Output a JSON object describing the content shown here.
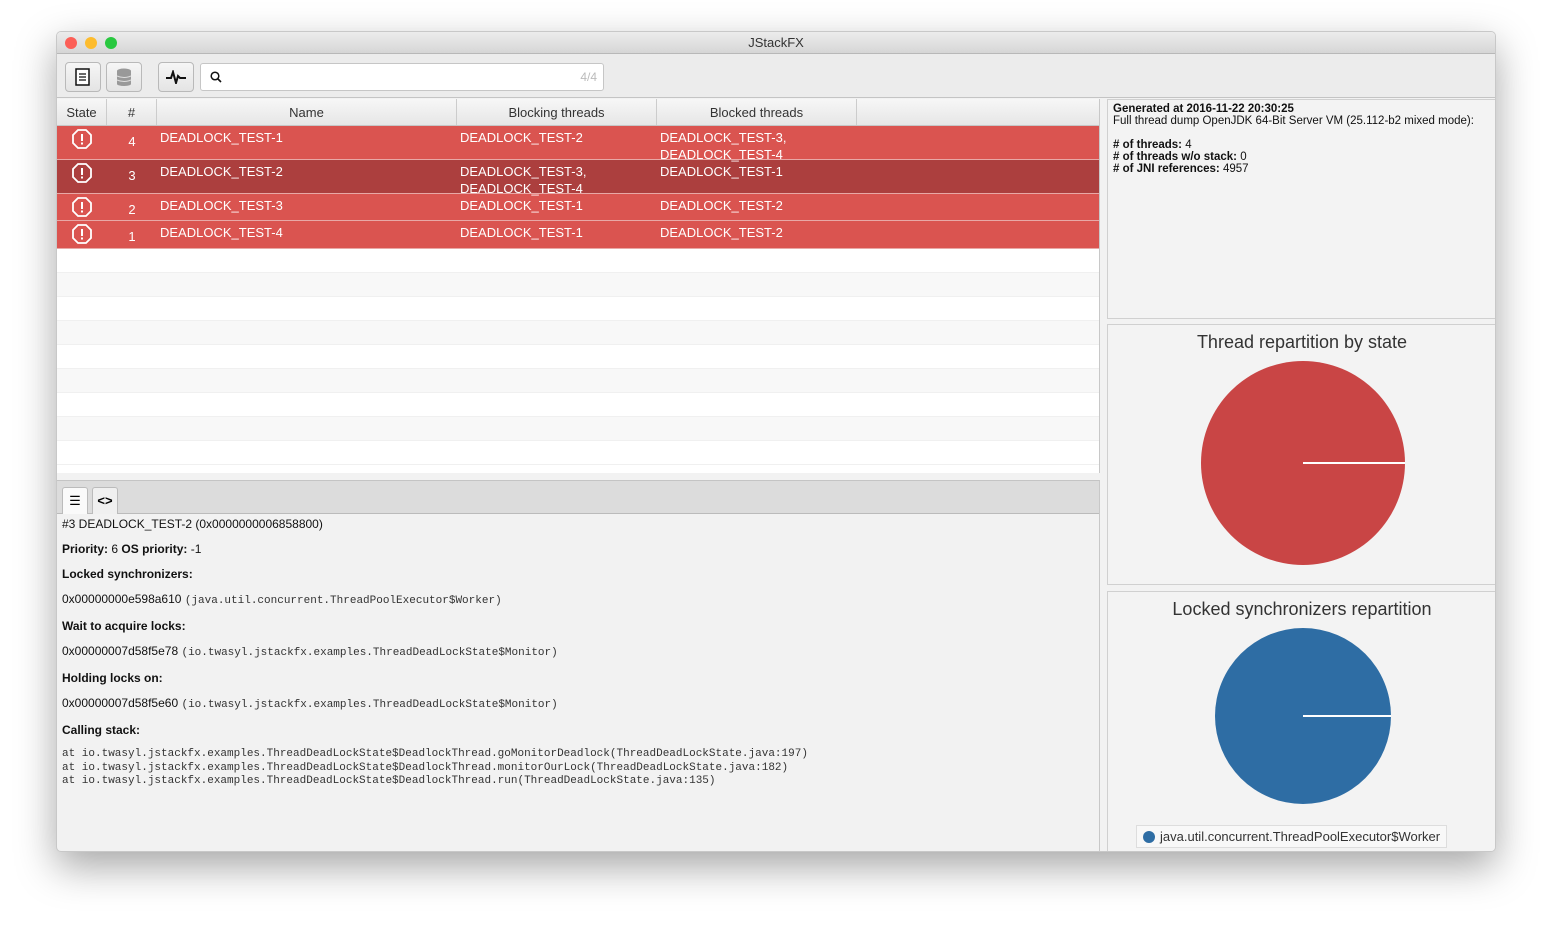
{
  "window": {
    "title": "JStackFX"
  },
  "toolbar": {
    "search_placeholder": "",
    "search_value": "",
    "match_count": "4/4"
  },
  "table": {
    "columns": [
      "State",
      "#",
      "Name",
      "Blocking threads",
      "Blocked threads"
    ],
    "rows": [
      {
        "state": "deadlock",
        "num": "4",
        "name": "DEADLOCK_TEST-1",
        "blocking": "DEADLOCK_TEST-2",
        "blocked": "DEADLOCK_TEST-3,\nDEADLOCK_TEST-4",
        "selected": false
      },
      {
        "state": "deadlock",
        "num": "3",
        "name": "DEADLOCK_TEST-2",
        "blocking": "DEADLOCK_TEST-3,\nDEADLOCK_TEST-4",
        "blocked": "DEADLOCK_TEST-1",
        "selected": true
      },
      {
        "state": "deadlock",
        "num": "2",
        "name": "DEADLOCK_TEST-3",
        "blocking": "DEADLOCK_TEST-1",
        "blocked": "DEADLOCK_TEST-2",
        "selected": false
      },
      {
        "state": "deadlock",
        "num": "1",
        "name": "DEADLOCK_TEST-4",
        "blocking": "DEADLOCK_TEST-1",
        "blocked": "DEADLOCK_TEST-2",
        "selected": false
      }
    ]
  },
  "details": {
    "header": "#3 DEADLOCK_TEST-2 (0x0000000006858800)",
    "priority_label": "Priority:",
    "priority": "6",
    "os_priority_label": "OS priority:",
    "os_priority": "-1",
    "locked_sync_label": "Locked synchronizers:",
    "locked_sync_addr": "0x00000000e598a610",
    "locked_sync_class": "(java.util.concurrent.ThreadPoolExecutor$Worker)",
    "wait_label": "Wait to acquire locks:",
    "wait_addr": "0x00000007d58f5e78",
    "wait_class": "(io.twasyl.jstackfx.examples.ThreadDeadLockState$Monitor)",
    "holding_label": "Holding locks on:",
    "holding_addr": "0x00000007d58f5e60",
    "holding_class": "(io.twasyl.jstackfx.examples.ThreadDeadLockState$Monitor)",
    "stack_label": "Calling stack:",
    "stack": [
      "at io.twasyl.jstackfx.examples.ThreadDeadLockState$DeadlockThread.goMonitorDeadlock(ThreadDeadLockState.java:197)",
      "at io.twasyl.jstackfx.examples.ThreadDeadLockState$DeadlockThread.monitorOurLock(ThreadDeadLockState.java:182)",
      "at io.twasyl.jstackfx.examples.ThreadDeadLockState$DeadlockThread.run(ThreadDeadLockState.java:135)"
    ]
  },
  "info": {
    "generated": "Generated at 2016-11-22 20:30:25",
    "dump": "Full thread dump OpenJDK 64-Bit Server VM (25.112-b2 mixed mode):",
    "threads_label": "# of threads:",
    "threads": "4",
    "nostack_label": "# of threads w/o stack:",
    "nostack": "0",
    "jni_label": "# of JNI references:",
    "jni": "4957"
  },
  "chart_data": [
    {
      "type": "pie",
      "title": "Thread repartition by state",
      "slices": [
        {
          "value": 4,
          "color": "#c94545"
        }
      ]
    },
    {
      "type": "pie",
      "title": "Locked synchronizers repartition",
      "slices": [
        {
          "name": "java.util.concurrent.ThreadPoolExecutor$Worker",
          "value": 1,
          "color": "#2e6da4"
        }
      ],
      "legend": "bottom"
    }
  ]
}
